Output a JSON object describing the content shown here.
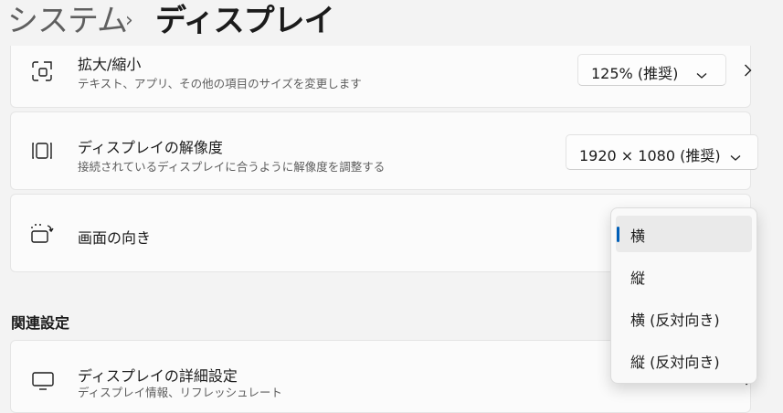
{
  "breadcrumb": {
    "parent": "システム",
    "separator": "›",
    "current": "ディスプレイ"
  },
  "scale": {
    "title": "拡大/縮小",
    "subtitle": "テキスト、アプリ、その他の項目のサイズを変更します",
    "value": "125% (推奨)",
    "icon": "scale-icon"
  },
  "resolution": {
    "title": "ディスプレイの解像度",
    "subtitle": "接続されているディスプレイに合うように解像度を調整する",
    "value": "1920 × 1080 (推奨)",
    "icon": "resolution-icon"
  },
  "orientation": {
    "title": "画面の向き",
    "icon": "orientation-icon",
    "options": [
      "横",
      "縦",
      "横 (反対向き)",
      "縦 (反対向き)"
    ],
    "selected": "横"
  },
  "related": {
    "section_title": "関連設定",
    "advanced_title": "ディスプレイの詳細設定",
    "advanced_subtitle": "ディスプレイ情報、リフレッシュレート",
    "icon": "monitor-icon"
  },
  "colors": {
    "accent": "#005fb8",
    "background": "#f3f3f3",
    "card": "#fbfbfb"
  }
}
